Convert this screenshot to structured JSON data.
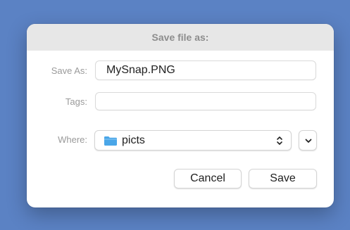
{
  "dialog": {
    "title": "Save file as:"
  },
  "form": {
    "save_as": {
      "label": "Save As:",
      "value": "MySnap.PNG"
    },
    "tags": {
      "label": "Tags:",
      "value": ""
    },
    "where": {
      "label": "Where:",
      "value": "picts",
      "icon": "folder-icon"
    }
  },
  "buttons": {
    "cancel": "Cancel",
    "save": "Save"
  },
  "colors": {
    "desktop_background": "#5b82c4",
    "folder": "#4aa6e8"
  }
}
